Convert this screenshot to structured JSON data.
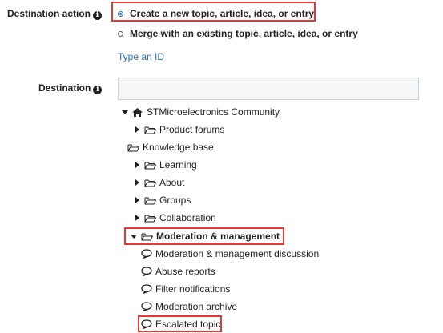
{
  "destination_action": {
    "label": "Destination action",
    "options": [
      {
        "label": "Create a new topic, article, idea, or entry",
        "checked": true
      },
      {
        "label": "Merge with an existing topic, article, idea, or entry",
        "checked": false
      }
    ],
    "type_id_link": "Type an ID"
  },
  "destination": {
    "label": "Destination",
    "input_value": "",
    "tree": {
      "root": "STMicroelectronics Community",
      "items": [
        "Product forums",
        "Knowledge base",
        "Learning",
        "About",
        "Groups",
        "Collaboration",
        "Moderation & management"
      ],
      "moderation_children": [
        "Moderation & management discussion",
        "Abuse reports",
        "Filter notifications",
        "Moderation archive",
        "Escalated topic"
      ]
    }
  },
  "colors": {
    "highlight": "#e53935",
    "link": "#2a6fb8",
    "radio": "#2b6cb0"
  },
  "icons": [
    "info-icon",
    "home-icon",
    "folder-icon",
    "speech-bubble-icon",
    "caret-right-icon",
    "caret-down-icon"
  ]
}
